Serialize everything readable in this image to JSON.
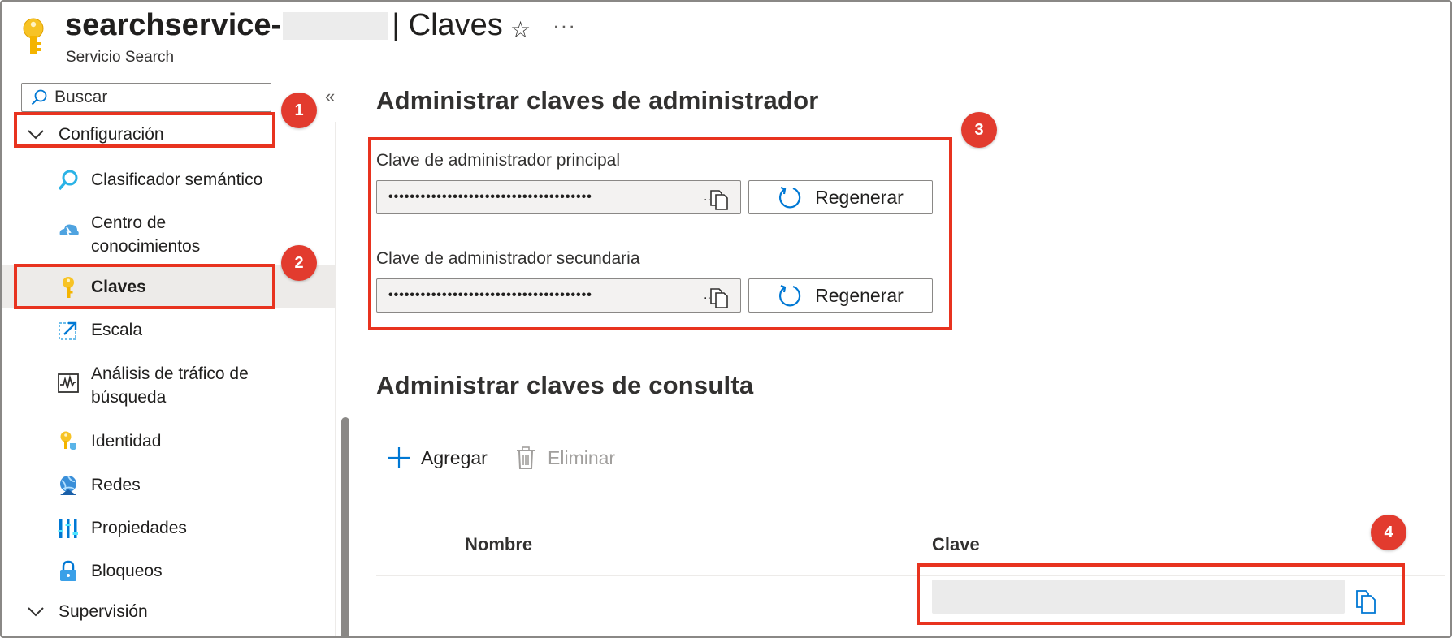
{
  "header": {
    "resource_name": "searchservice-",
    "separator_title": "| Claves",
    "subtitle": "Servicio Search",
    "favorite_icon": "star-icon",
    "more_icon": "ellipsis-icon",
    "more_label": "···"
  },
  "sidebar": {
    "search_placeholder": "Buscar",
    "collapse_label": "«",
    "groups": [
      {
        "label": "Configuración",
        "expanded": true
      },
      {
        "label": "Supervisión",
        "expanded": false
      }
    ],
    "items": [
      {
        "label": "Clasificador semántico",
        "icon": "semantic-ranker-icon"
      },
      {
        "label_line1": "Centro de",
        "label_line2": "conocimientos",
        "icon": "knowledge-center-icon"
      },
      {
        "label": "Claves",
        "icon": "key-icon",
        "selected": true
      },
      {
        "label": "Escala",
        "icon": "scale-icon"
      },
      {
        "label_line1": "Análisis de tráfico de",
        "label_line2": "búsqueda",
        "icon": "traffic-analytics-icon"
      },
      {
        "label": "Identidad",
        "icon": "identity-icon"
      },
      {
        "label": "Redes",
        "icon": "networking-icon"
      },
      {
        "label": "Propiedades",
        "icon": "properties-icon"
      },
      {
        "label": "Bloqueos",
        "icon": "lock-icon"
      }
    ]
  },
  "admin_keys": {
    "heading": "Administrar claves de administrador",
    "primary_label": "Clave de administrador principal",
    "primary_value": "••••••••••••••••••••••••••••••••••••••",
    "secondary_label": "Clave de administrador secundaria",
    "secondary_value": "••••••••••••••••••••••••••••••••••••••",
    "ellipsis": "..",
    "regenerate_label": "Regenerar"
  },
  "query_keys": {
    "heading": "Administrar claves de consulta",
    "add_label": "Agregar",
    "delete_label": "Eliminar",
    "columns": [
      "Nombre",
      "Clave"
    ]
  },
  "callouts": [
    "1",
    "2",
    "3",
    "4"
  ],
  "colors": {
    "accent": "#0078d4",
    "highlight": "#e8331f",
    "badge": "#e23b2e",
    "key_gold": "#f4b400"
  }
}
